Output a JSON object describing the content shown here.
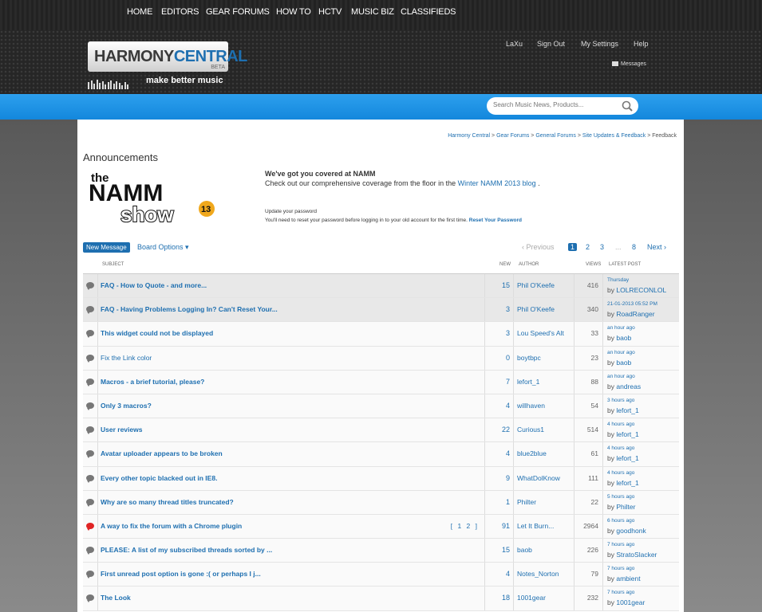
{
  "header": {
    "logo_part1": "HARMONY",
    "logo_part2": "CENTRAL",
    "logo_beta": "BETA",
    "tagline": "make better music",
    "user": "LaXu",
    "sign_out": "Sign Out",
    "my_settings": "My Settings",
    "help": "Help",
    "messages": "Messages"
  },
  "nav": {
    "items": [
      "HOME",
      "EDITORS",
      "GEAR FORUMS",
      "HOW TO",
      "HCTV",
      "MUSIC BIZ",
      "CLASSIFIEDS"
    ],
    "search_placeholder": "Search Music News, Products..."
  },
  "breadcrumb": {
    "items": [
      "Harmony Central",
      "Gear Forums",
      "General Forums",
      "Site Updates & Feedback"
    ],
    "current": "Feedback"
  },
  "announcements": {
    "title": "Announcements",
    "logo_the": "the",
    "logo_namm": "NAMM",
    "logo_show": "show",
    "logo_year": "13",
    "namm_heading": "We've got you covered at NAMM",
    "namm_text": "Check out our comprehensive coverage from the floor in the",
    "namm_link": "Winter NAMM 2013 blog",
    "namm_end": ".",
    "reset_heading": "Update your password",
    "reset_text": "You'll need to reset your password before logging in to your old account for the first time.",
    "reset_link": "Reset Your Password"
  },
  "toolbar": {
    "new_message": "New Message",
    "board_options": "Board Options ▾",
    "previous": "‹ Previous",
    "pages": [
      "1",
      "2",
      "3",
      "...",
      "8"
    ],
    "next": "Next ›"
  },
  "columns": {
    "subject": "SUBJECT",
    "new": "NEW",
    "author": "AUTHOR",
    "views": "VIEWS",
    "latest": "LATEST POST"
  },
  "threads": [
    {
      "subject": "FAQ - How to Quote - and more...",
      "new": "15",
      "author": "Phil O'Keefe",
      "views": "416",
      "time": "Thursday",
      "by": "LOLRECONLOL",
      "sticky": true
    },
    {
      "subject": "FAQ - Having Problems Logging In? Can't Reset Your...",
      "new": "3",
      "author": "Phil O'Keefe",
      "views": "340",
      "time": "21-01-2013 05:52 PM",
      "by": "RoadRanger",
      "sticky": true
    },
    {
      "subject": "This widget could not be displayed",
      "new": "3",
      "author": "Lou Speed's Alt",
      "views": "33",
      "time": "an hour ago",
      "by": "baob"
    },
    {
      "subject": "Fix the Link color",
      "new": "0",
      "author": "boytbpc",
      "views": "23",
      "time": "an hour ago",
      "by": "baob",
      "plain": true
    },
    {
      "subject": "Macros - a brief tutorial, please?",
      "new": "7",
      "author": "lefort_1",
      "views": "88",
      "time": "an hour ago",
      "by": "andreas"
    },
    {
      "subject": "Only 3 macros?",
      "new": "4",
      "author": "willhaven",
      "views": "54",
      "time": "3 hours ago",
      "by": "lefort_1"
    },
    {
      "subject": "User reviews",
      "new": "22",
      "author": "Curious1",
      "views": "514",
      "time": "4 hours ago",
      "by": "lefort_1"
    },
    {
      "subject": "Avatar uploader appears to be broken",
      "new": "4",
      "author": "blue2blue",
      "views": "61",
      "time": "4 hours ago",
      "by": "lefort_1"
    },
    {
      "subject": "Every other topic blacked out in IE8.",
      "new": "9",
      "author": "WhatDolKnow",
      "views": "111",
      "time": "4 hours ago",
      "by": "lefort_1"
    },
    {
      "subject": "Why are so many thread titles truncated?",
      "new": "1",
      "author": "Philter",
      "views": "22",
      "time": "5 hours ago",
      "by": "Philter"
    },
    {
      "subject": "A way to fix the forum with a Chrome plugin",
      "new": "91",
      "author": "Let It Burn...",
      "views": "2964",
      "time": "6 hours ago",
      "by": "goodhonk",
      "hot": true,
      "pages": "[ 1 2 ]"
    },
    {
      "subject": "PLEASE: A list of my subscribed threads sorted by ...",
      "new": "15",
      "author": "baob",
      "views": "226",
      "time": "7 hours ago",
      "by": "StratoSlacker"
    },
    {
      "subject": "First unread post option is gone :( or perhaps I j...",
      "new": "4",
      "author": "Notes_Norton",
      "views": "79",
      "time": "7 hours ago",
      "by": "ambient"
    },
    {
      "subject": "The Look",
      "new": "18",
      "author": "1001gear",
      "views": "232",
      "time": "7 hours ago",
      "by": "1001gear"
    }
  ],
  "by_prefix": "by",
  "colors": {
    "accent": "#1e6fb0",
    "nav": "#1a8fe3",
    "hot": "#e02424"
  }
}
